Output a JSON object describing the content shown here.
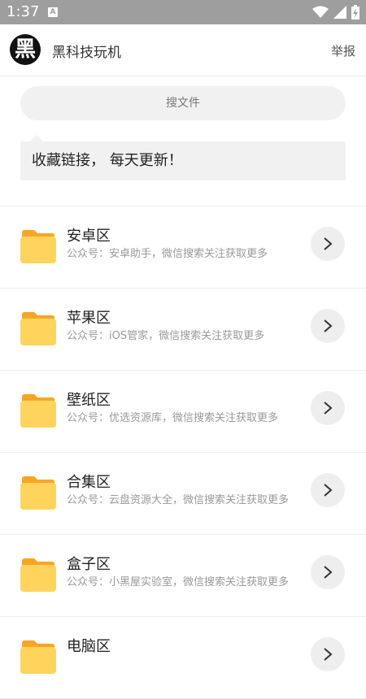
{
  "status_bar": {
    "time": "1:37",
    "notification_letter": "A"
  },
  "header": {
    "title": "黑科技玩机",
    "avatar_text": "黑",
    "report_label": "举报"
  },
  "search": {
    "label": "搜文件"
  },
  "notice": {
    "text": "收藏链接，  每天更新！"
  },
  "colors": {
    "folder_tab": "#f7a623",
    "folder_body": "#ffd45c",
    "status_bar": "#9e9e9e"
  },
  "items": [
    {
      "title": "安卓区",
      "desc": "公众号：安卓助手，微信搜索关注获取更多"
    },
    {
      "title": "苹果区",
      "desc": "公众号：iOS管家，微信搜索关注获取更多"
    },
    {
      "title": "壁纸区",
      "desc": "公众号：优选资源库，微信搜索关注获取更多"
    },
    {
      "title": "合集区",
      "desc": "公众号：云盘资源大全，微信搜索关注获取更多"
    },
    {
      "title": "盒子区",
      "desc": "公众号：小黑屋实验室，微信搜索关注获取更多"
    },
    {
      "title": "电脑区",
      "desc": ""
    }
  ]
}
